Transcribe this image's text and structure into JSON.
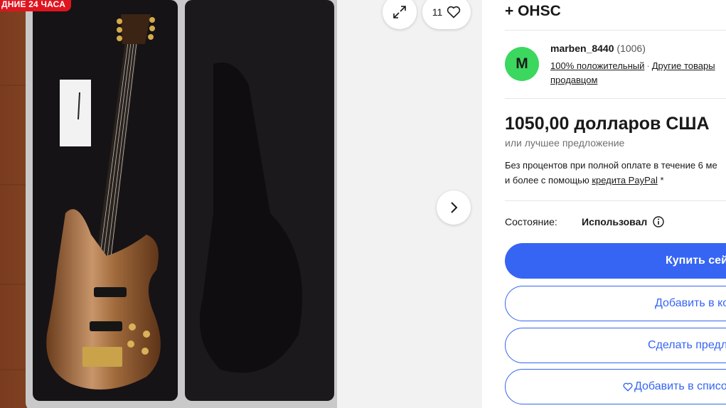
{
  "gallery": {
    "badge": "ДНИЕ 24 ЧАСА",
    "expand_icon": "expand-icon",
    "watch_count": "11",
    "heart_icon": "heart-icon",
    "next_icon": "chevron-right-icon"
  },
  "listing": {
    "title_tail": "+ OHSC"
  },
  "seller": {
    "initial": "M",
    "name": "marben_8440",
    "feedback_count": "(1006)",
    "positive": "100% положительный",
    "separator": "·",
    "other_items": "Другие товары",
    "other_items_2": "продавцом"
  },
  "price": {
    "amount": "1050,00 долларов США",
    "best_offer": "или лучшее предложение",
    "financing_line1": "Без процентов при полной оплате в течение 6 ме",
    "financing_line2_prefix": "и более с помощью ",
    "financing_link": "кредита PayPal",
    "financing_suffix": " *"
  },
  "condition": {
    "label": "Состояние:",
    "value": "Использовал",
    "info_icon": "info-icon"
  },
  "actions": {
    "buy_now": "Купить сей",
    "add_to_cart": "Добавить в ко",
    "make_offer": "Сделать предл",
    "add_to_watchlist": "Добавить в списо"
  },
  "colors": {
    "accent": "#3665f3",
    "badge": "#e0141e",
    "avatar": "#3bd75e"
  }
}
